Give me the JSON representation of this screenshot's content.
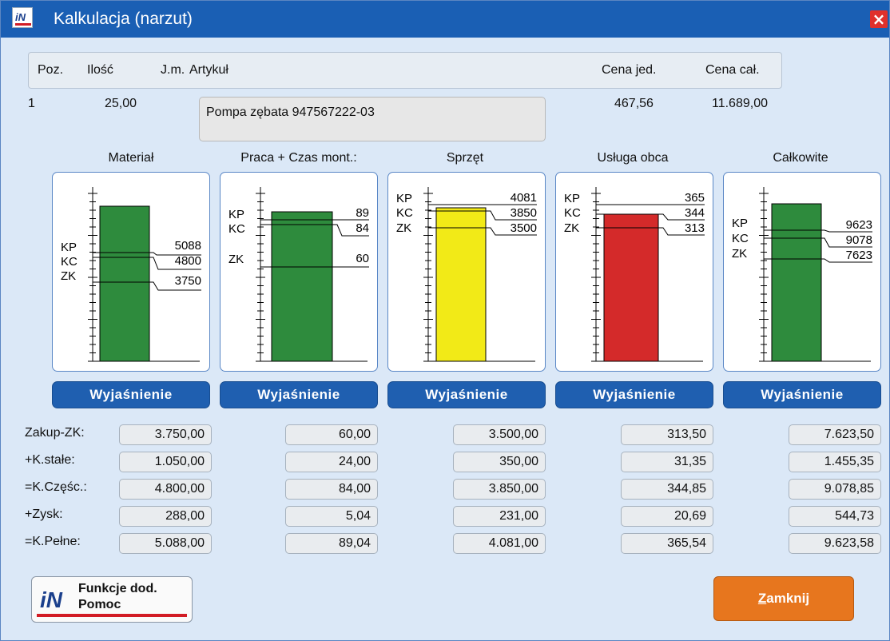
{
  "window": {
    "title": "Kalkulacja (narzut)"
  },
  "header": {
    "poz": "Poz.",
    "ilosc": "Ilość",
    "jm": "J.m.",
    "artykul": "Artykuł",
    "cena_jed": "Cena jed.",
    "cena_cal": "Cena cał."
  },
  "item": {
    "poz": "1",
    "ilosc": "25,00",
    "artykul": "Pompa zębata 947567222-03",
    "cena_jed": "467,56",
    "cena_cal": "11.689,00"
  },
  "columns": [
    {
      "title": "Materiał",
      "bar_color": "#2e8b3d",
      "kp": "5088",
      "kc": "4800",
      "zk": "3750",
      "explain": "Wyjaśnienie"
    },
    {
      "title": "Praca + Czas mont.:",
      "bar_color": "#2e8b3d",
      "kp": "89",
      "kc": "84",
      "zk": "60",
      "explain": "Wyjaśnienie"
    },
    {
      "title": "Sprzęt",
      "bar_color": "#f2ea17",
      "kp": "4081",
      "kc": "3850",
      "zk": "3500",
      "explain": "Wyjaśnienie"
    },
    {
      "title": "Usługa obca",
      "bar_color": "#d42a2a",
      "kp": "365",
      "kc": "344",
      "zk": "313",
      "explain": "Wyjaśnienie"
    },
    {
      "title": "Całkowite",
      "bar_color": "#2e8b3d",
      "kp": "9623",
      "kc": "9078",
      "zk": "7623",
      "explain": "Wyjaśnienie"
    }
  ],
  "chart_labels": {
    "kp": "KP",
    "kc": "KC",
    "zk": "ZK"
  },
  "rows": [
    {
      "label": "Zakup-ZK:",
      "values": [
        "3.750,00",
        "60,00",
        "3.500,00",
        "313,50",
        "7.623,50"
      ]
    },
    {
      "label": "+K.stałe:",
      "values": [
        "1.050,00",
        "24,00",
        "350,00",
        "31,35",
        "1.455,35"
      ]
    },
    {
      "label": "=K.Częśc.:",
      "values": [
        "4.800,00",
        "84,00",
        "3.850,00",
        "344,85",
        "9.078,85"
      ]
    },
    {
      "label": "+Zysk:",
      "values": [
        "288,00",
        "5,04",
        "231,00",
        "20,69",
        "544,73"
      ]
    },
    {
      "label": "=K.Pełne:",
      "values": [
        "5.088,00",
        "89,04",
        "4.081,00",
        "365,54",
        "9.623,58"
      ]
    }
  ],
  "buttons": {
    "func_line1": "Funkcje dod.",
    "func_line2": "Pomoc",
    "close_u": "Z",
    "close_rest": "amknij"
  }
}
